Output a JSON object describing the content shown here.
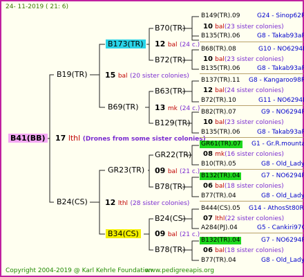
{
  "header": {
    "date": "24- 11-2019  ( 21:  6)"
  },
  "footer": {
    "copyright": "Copyright 2004-2019 @ Karl Kehrle Foundation",
    "site": "www.pedigreeapis.org"
  },
  "root": {
    "label": "B41(BB)"
  },
  "center": {
    "num": "17",
    "code": "lthl",
    "note": "(Drones from some sister colonies)"
  },
  "gen1": {
    "top": {
      "label": "B19(TR)"
    },
    "top_info": {
      "num": "15",
      "code": "bal",
      "note": "(20 sister colonies)"
    },
    "bottom": {
      "label": "B24(CS)"
    },
    "bottom_info": {
      "num": "12",
      "code": "lthl",
      "note": "(28 sister colonies)"
    }
  },
  "gen2": [
    {
      "label": "B173(TR)",
      "num": "12",
      "code": "bal",
      "note": "(24 c.)"
    },
    {
      "label": "B69(TR)",
      "num": "13",
      "code": "mk",
      "note": "(24 c.)"
    },
    {
      "label": "GR23(TR)",
      "num": "09",
      "code": "bal",
      "note": "(21 c.)"
    },
    {
      "label": "B34(CS)",
      "num": "09",
      "code": "bal",
      "note": "(21 c.)"
    }
  ],
  "gen3": [
    "B70(TR)",
    "B72(TR)",
    "B63(TR)",
    "B129(TR)",
    "GR22(TR)",
    "B78(TR)",
    "B24(CS)",
    "B78(TR)"
  ],
  "gen4": [
    {
      "top": "B149(TR).09",
      "top_id": "G24 - Sinop62R",
      "num": "10",
      "code": "bal",
      "note": "(23 sister colonies)",
      "bottom": "B135(TR).06",
      "bottom_id": "G8 - Takab93aR"
    },
    {
      "top": "B68(TR).08",
      "top_id": "G10 - NO6294R",
      "num": "10",
      "code": "bal",
      "note": "(23 sister colonies)",
      "bottom": "B135(TR).06",
      "bottom_id": "G8 - Takab93aR"
    },
    {
      "top": "B137(TR).11",
      "top_id": "G8 - Kangaroo98R",
      "num": "12",
      "code": "bal",
      "note": "(24 sister colonies)",
      "bottom": "B72(TR).10",
      "bottom_id": "G11 - NO6294R"
    },
    {
      "top": "B82(TR).07",
      "top_id": "G9 - NO6294R",
      "num": "10",
      "code": "bal",
      "note": "(23 sister colonies)",
      "bottom": "B135(TR).06",
      "bottom_id": "G8 - Takab93aR"
    },
    {
      "top": "GR61(TR).07",
      "top_id": "G1 - Gr.R.mounta",
      "num": "08",
      "code": "mk",
      "note": "(16 sister colonies)",
      "bottom": "B10(TR).05",
      "bottom_id": "G8 - Old_Lady"
    },
    {
      "top": "B132(TR).04",
      "top_id": "G7 - NO6294R",
      "num": "06",
      "code": "bal",
      "note": "(18 sister colonies)",
      "bottom": "B77(TR).04",
      "bottom_id": "G8 - Old_Lady"
    },
    {
      "top": "B444(CS).05",
      "top_id": "G14 - AthosSt80R",
      "num": "07",
      "code": "lthl",
      "note": "(22 sister colonies)",
      "bottom": "A284(PJ).04",
      "bottom_id": "G5 - Cankiri97Q"
    },
    {
      "top": "B132(TR).04",
      "top_id": "G7 - NO6294R",
      "num": "06",
      "code": "bal",
      "note": "(18 sister colonies)",
      "bottom": "B77(TR).04",
      "bottom_id": "G8 - Old_Lady"
    }
  ]
}
